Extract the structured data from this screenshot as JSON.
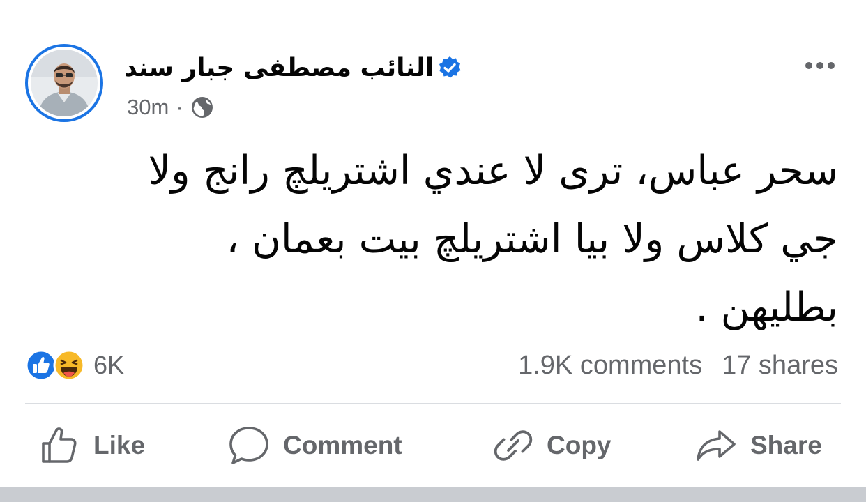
{
  "post": {
    "author": "النائب مصطفى جبار سند",
    "time": "30m",
    "separator": "·",
    "text": "سحر عباس، ترى لا عندي اشتريلچ رانج ولا\nجي كلاس ولا بيا اشتريلچ بيت بعمان ،\nبطليهن ."
  },
  "stats": {
    "reaction_count": "6K",
    "comments": "1.9K comments",
    "shares": "17 shares"
  },
  "actions": {
    "like": "Like",
    "comment": "Comment",
    "copy": "Copy",
    "share": "Share"
  },
  "icons": {
    "verified": "verified-badge-icon",
    "audience": "globe-icon",
    "more": "more-options-icon",
    "reaction_like": "like-reaction-icon",
    "reaction_haha": "haha-reaction-icon"
  },
  "colors": {
    "accent": "#1b74e4",
    "secondary_text": "#65676b",
    "primary_text": "#050505"
  }
}
